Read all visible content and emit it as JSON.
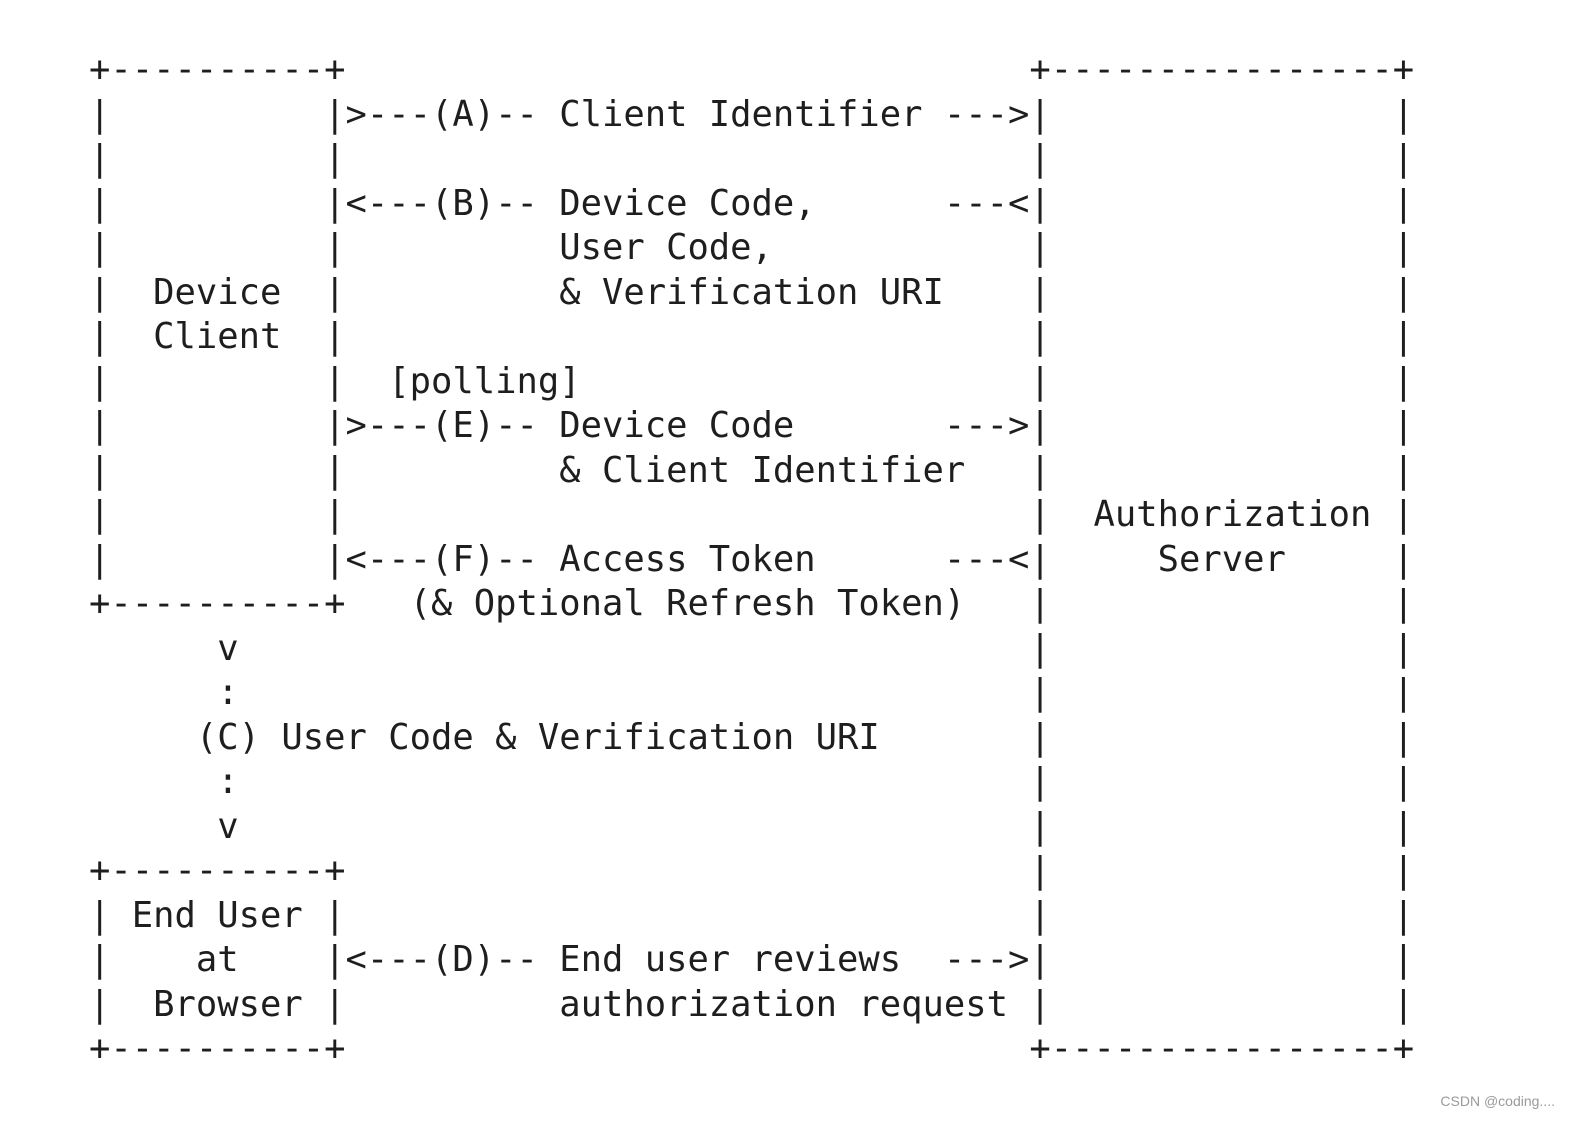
{
  "diagram": {
    "lines": [
      "+----------+                                +----------------+",
      "|          |>---(A)-- Client Identifier --->|                |",
      "|          |                                |                |",
      "|          |<---(B)-- Device Code,      ---<|                |",
      "|          |          User Code,            |                |",
      "|  Device  |          & Verification URI    |                |",
      "|  Client  |                                |                |",
      "|          |  [polling]                     |                |",
      "|          |>---(E)-- Device Code       --->|                |",
      "|          |          & Client Identifier   |                |",
      "|          |                                |  Authorization |",
      "|          |<---(F)-- Access Token      ---<|     Server     |",
      "+----------+   (& Optional Refresh Token)   |                |",
      "      v                                     |                |",
      "      :                                     |                |",
      "     (C) User Code & Verification URI       |                |",
      "      :                                     |                |",
      "      v                                     |                |",
      "+----------+                                |                |",
      "| End User |                                |                |",
      "|    at    |<---(D)-- End user reviews  --->|                |",
      "|  Browser |          authorization request |                |",
      "+----------+                                +----------------+"
    ]
  },
  "watermark": "CSDN @coding...."
}
